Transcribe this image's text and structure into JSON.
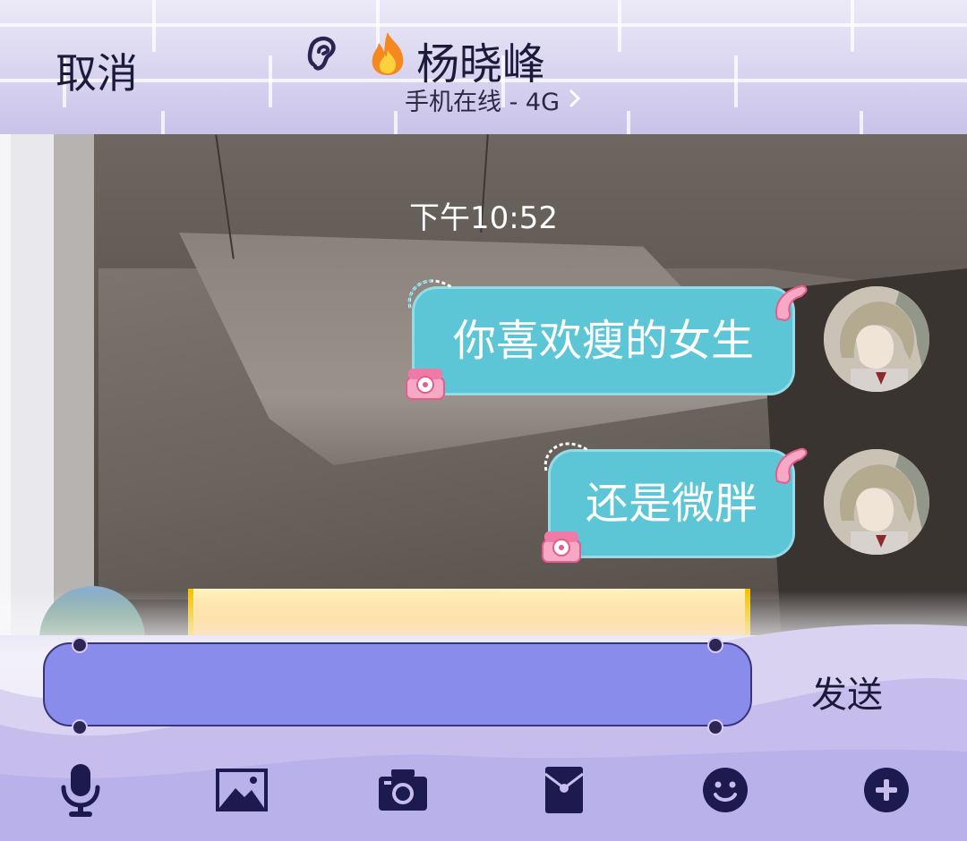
{
  "header": {
    "cancel_label": "取消",
    "contact_name": "杨晓峰",
    "status": "手机在线 - 4G",
    "icons": [
      "ear-icon",
      "fire-icon",
      "chevron-right-icon"
    ]
  },
  "chat": {
    "timestamp": "下午10:52",
    "messages": [
      {
        "text": "你喜欢瘦的女生",
        "sender": "self"
      },
      {
        "text": "还是微胖",
        "sender": "self"
      }
    ],
    "bubble_color": "#5cc6d6"
  },
  "composer": {
    "input_value": "",
    "send_label": "发送",
    "input_color": "#8a8cec"
  },
  "toolbar": {
    "icons": [
      "microphone-icon",
      "image-icon",
      "camera-icon",
      "red-envelope-icon",
      "emoji-icon",
      "plus-icon"
    ]
  }
}
